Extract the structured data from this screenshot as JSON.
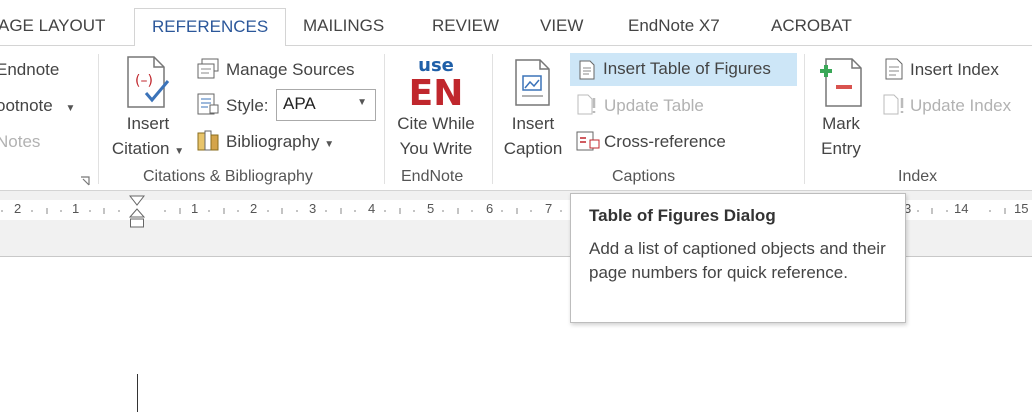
{
  "tabs": [
    "AGE LAYOUT",
    "REFERENCES",
    "MAILINGS",
    "REVIEW",
    "VIEW",
    "EndNote X7",
    "ACROBAT"
  ],
  "active_tab": "REFERENCES",
  "footnotes": {
    "endnote": "Endnote",
    "footnote": "ootnote",
    "notes": "Notes"
  },
  "citations": {
    "insert_citation_line1": "Insert",
    "insert_citation_line2": "Citation",
    "manage_sources": "Manage Sources",
    "style_label": "Style:",
    "style_value": "APA",
    "bibliography": "Bibliography",
    "group_label": "Citations & Bibliography"
  },
  "endnote": {
    "logo_top": "use",
    "logo_main": "EN",
    "cite_line1": "Cite While",
    "cite_line2": "You Write",
    "group_label": "EndNote"
  },
  "captions": {
    "insert_caption_line1": "Insert",
    "insert_caption_line2": "Caption",
    "insert_table_of_figures": "Insert Table of Figures",
    "update_table": "Update Table",
    "cross_reference": "Cross-reference",
    "group_label": "Captions"
  },
  "index": {
    "mark_entry_line1": "Mark",
    "mark_entry_line2": "Entry",
    "insert_index": "Insert Index",
    "update_index": "Update Index",
    "group_label": "Index"
  },
  "ruler": {
    "left_numbers": [
      "2",
      "1"
    ],
    "right_numbers": [
      "1",
      "2",
      "3",
      "4",
      "5",
      "6",
      "7"
    ],
    "far_right_numbers": [
      "3",
      "14",
      "15"
    ]
  },
  "tooltip": {
    "title": "Table of Figures Dialog",
    "description": "Add a list of captioned objects and their page numbers for quick reference."
  },
  "colors": {
    "accent": "#2b579a",
    "highlight": "#cde6f7",
    "endnote_red": "#c0272d",
    "endnote_blue": "#1f5fa8"
  }
}
